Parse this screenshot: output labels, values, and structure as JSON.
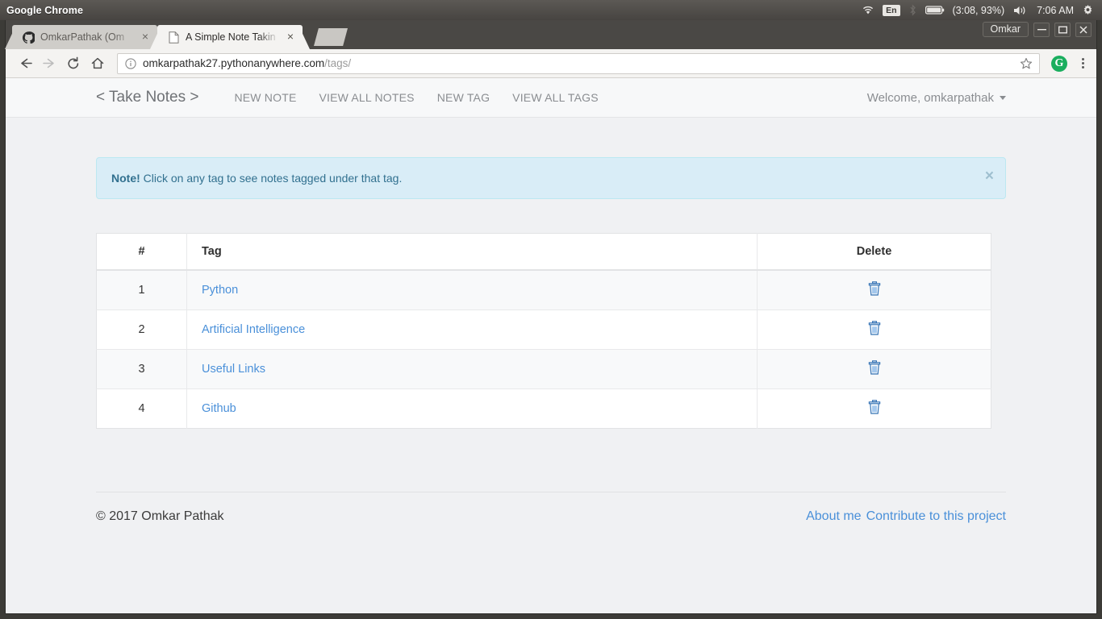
{
  "system": {
    "app_name": "Google Chrome",
    "tray": {
      "wifi_icon": "wifi-icon",
      "keyboard_layout": "En",
      "bluetooth_icon": "bluetooth-icon",
      "battery_icon": "battery-icon",
      "battery_status": "(3:08, 93%)",
      "volume_icon": "volume-icon",
      "clock": "7:06 AM",
      "settings_icon": "gear-icon"
    }
  },
  "window": {
    "user_label": "Omkar",
    "minimize_label": "—",
    "maximize_label": "❐",
    "close_label": "×"
  },
  "tabs": [
    {
      "title": "OmkarPathak (Om",
      "favicon": "github-icon",
      "active": false
    },
    {
      "title": "A Simple Note Takin",
      "favicon": "page-icon",
      "active": true
    }
  ],
  "toolbar": {
    "back_icon": "back-arrow-icon",
    "forward_icon": "forward-arrow-icon",
    "reload_icon": "reload-icon",
    "home_icon": "home-icon",
    "site_info_icon": "info-circle-icon",
    "url_host": "omkarpathak27.pythonanywhere.com",
    "url_path": "/tags/",
    "bookmark_icon": "star-icon",
    "extension_icon_label": "G",
    "menu_icon": "kebab-menu-icon"
  },
  "site_nav": {
    "brand": "< Take Notes >",
    "links": [
      {
        "label": "NEW NOTE"
      },
      {
        "label": "VIEW ALL NOTES"
      },
      {
        "label": "NEW TAG"
      },
      {
        "label": "VIEW ALL TAGS"
      }
    ],
    "user_menu": "Welcome, omkarpathak"
  },
  "alert": {
    "strong": "Note!",
    "message": " Click on any tag to see notes tagged under that tag.",
    "close_label": "×"
  },
  "table": {
    "headers": {
      "num": "#",
      "tag": "Tag",
      "delete": "Delete"
    },
    "rows": [
      {
        "num": "1",
        "tag": "Python",
        "delete_icon": "trash-icon"
      },
      {
        "num": "2",
        "tag": "Artificial Intelligence",
        "delete_icon": "trash-icon"
      },
      {
        "num": "3",
        "tag": "Useful Links",
        "delete_icon": "trash-icon"
      },
      {
        "num": "4",
        "tag": "Github",
        "delete_icon": "trash-icon"
      }
    ]
  },
  "footer": {
    "copyright": "© 2017 Omkar Pathak",
    "links": [
      {
        "label": "About me"
      },
      {
        "label": "Contribute to this project"
      }
    ]
  },
  "colors": {
    "link_blue": "#4a90d9",
    "alert_bg": "#d9edf7",
    "alert_border": "#bce8f1",
    "alert_text": "#31708f",
    "page_bg": "#f0f1f3",
    "extension_green": "#1aae5e"
  }
}
